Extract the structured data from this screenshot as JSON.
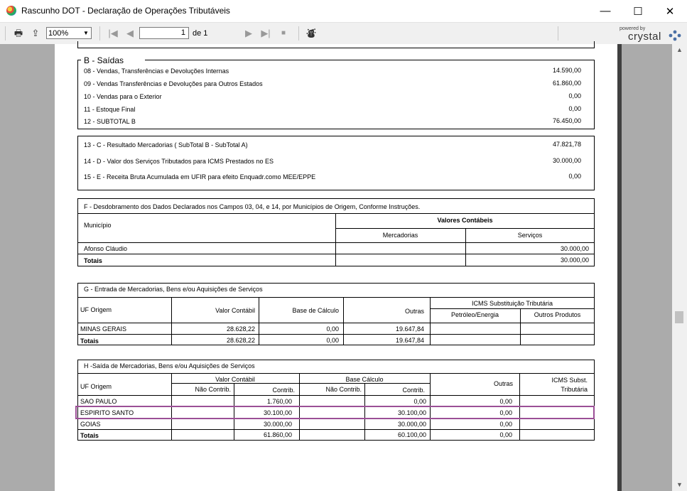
{
  "window": {
    "title": "Rascunho DOT - Declaração de Operações Tributáveis",
    "minimize": "—",
    "maximize": "☐",
    "close": "✕"
  },
  "toolbar": {
    "zoom": "100%",
    "page": "1",
    "of": "de 1",
    "powered_by": "powered by",
    "brand": "crystal"
  },
  "section_b": {
    "title": "B - Saídas",
    "rows": [
      {
        "label": "08 - Vendas, Transferências e Devoluções Internas",
        "value": "14.590,00"
      },
      {
        "label": "09 - Vendas Transferências e Devoluções para Outros Estados",
        "value": "61.860,00"
      },
      {
        "label": "10 - Vendas para o Exterior",
        "value": "0,00"
      },
      {
        "label": "11 - Estoque Final",
        "value": "0,00"
      },
      {
        "label": "12 - SUBTOTAL B",
        "value": "76.450,00"
      }
    ]
  },
  "section_cde": {
    "rows": [
      {
        "label": "13 - C - Resultado Mercadorias ( SubTotal B - SubTotal A)",
        "value": "47.821,78"
      },
      {
        "label": "14 - D - Valor dos Serviços Tributados para ICMS Prestados no ES",
        "value": "30.000,00"
      },
      {
        "label": "15 - E - Receita Bruta Acumulada em UFIR para efeito Enquadr.como MEE/EPPE",
        "value": "0,00"
      }
    ]
  },
  "section_f": {
    "title": "F - Desdobramento dos Dados Declarados nos Campos 03, 04, e 14, por Municípios de Origem, Conforme Instruções.",
    "col_municipio": "Município",
    "col_valores": "Valores Contábeis",
    "col_mercadorias": "Mercadorias",
    "col_servicos": "Serviços",
    "rows": [
      {
        "municipio": "Afonso Cláudio",
        "mercadorias": "",
        "servicos": "30.000,00"
      }
    ],
    "totals": {
      "label": "Totais",
      "mercadorias": "",
      "servicos": "30.000,00"
    }
  },
  "section_g": {
    "title": "G - Entrada de Mercadorias, Bens e/ou Aquisições de Serviços",
    "headers": {
      "uf": "UF Origem",
      "valor": "Valor Contábil",
      "base": "Base de Cálculo",
      "outras": "Outras",
      "icms_st": "ICMS Substituição Tributária",
      "petroleo": "Petróleo/Energia",
      "outros_produtos": "Outros Produtos"
    },
    "rows": [
      {
        "uf": "MINAS GERAIS",
        "valor": "28.628,22",
        "base": "0,00",
        "outras": "19.647,84",
        "petroleo": "",
        "outros": ""
      }
    ],
    "totals": {
      "label": "Totais",
      "valor": "28.628,22",
      "base": "0,00",
      "outras": "19.647,84"
    }
  },
  "section_h": {
    "title": "H -Saída de Mercadorias, Bens e/ou Aquisições de Serviços",
    "headers": {
      "uf": "UF Origem",
      "valor": "Valor Contábil",
      "base": "Base Cálculo",
      "nao_contrib": "Não Contrib.",
      "contrib": "Contrib.",
      "outras": "Outras",
      "icms_st_1": "ICMS  Subst.",
      "icms_st_2": "Tributária"
    },
    "rows": [
      {
        "uf": "SAO PAULO",
        "v_nc": "",
        "v_c": "1.760,00",
        "b_nc": "",
        "b_c": "0,00",
        "outras": "0,00"
      },
      {
        "uf": "ESPIRITO SANTO",
        "v_nc": "",
        "v_c": "30.100,00",
        "b_nc": "",
        "b_c": "30.100,00",
        "outras": "0,00"
      },
      {
        "uf": "GOIAS",
        "v_nc": "",
        "v_c": "30.000,00",
        "b_nc": "",
        "b_c": "30.000,00",
        "outras": "0,00"
      }
    ],
    "totals": {
      "label": "Totais",
      "v_c": "61.860,00",
      "b_c": "60.100,00",
      "outras": "0,00"
    }
  }
}
